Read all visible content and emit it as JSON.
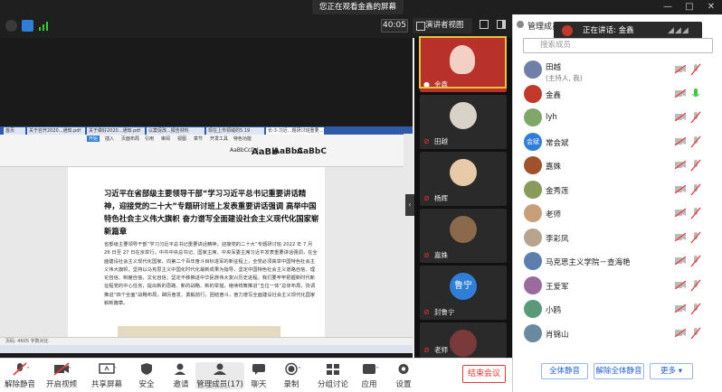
{
  "window": {
    "share_banner": "您正在观看金鑫的屏幕",
    "controls": [
      "—",
      "□",
      "✕"
    ]
  },
  "topbar": {
    "timer": "40:05",
    "view_mode": "演讲者视图"
  },
  "shared_screen": {
    "browser_tabs": [
      "首页",
      "关于召开2020...通知.pdf",
      "关于做好2020...通知.pdf",
      "以案促改...报告材料",
      "现在上市领域的5.19",
      "长-3-习近...题研讨班重要..."
    ],
    "ribbon_menus": [
      "开始",
      "插入",
      "页面布局",
      "引用",
      "审阅",
      "视图",
      "章节",
      "开发工具",
      "特色功能"
    ],
    "ribbon_styles": [
      "AaBbCcDd",
      "AaBb",
      "AaBbC",
      "AaBbC"
    ],
    "doc_title": "习近平在省部级主要领导干部“学习习近平总书记重要讲话精神，迎接党的二十大”专题研讨班上发表重要讲话强调 高举中国特色社会主义伟大旗帜 奋力谱写全面建设社会主义现代化国家崭新篇章",
    "doc_body": "省部级主要领导干部“学习习近平总书记重要讲话精神，迎接党的二十大”专题研讨班 2022 年 7 月 26 日至 27 日在京举行。中共中央总书记、国家主席、中央军委主席习近平发表重要讲话强调，在全面建设社会主义现代化国家、向第二个百年奋斗目标进军的新征程上，全党必须高举中国特色社会主义伟大旗帜，坚持以马克思主义中国化时代化最新成果为指导，坚定中国特色社会主义道路自信、理论自信、制度自信、文化自信，坚定不移推进中华民族伟大复兴历史进程。我们要牢牢把握新时代新征程党的中心任务，提出新的思路、新的战略、新的举措，继续统筹推进“五位一体”总体布局，协调推进“四个全面”战略布局，踔厉奋发、勇毅前行，团结奋斗，奋力谱写全面建设社会主义现代化国家崭新篇章。",
    "status": "页码: 4605    字数对比"
  },
  "gallery": [
    {
      "name": "金鑫",
      "muted": false
    },
    {
      "name": "田越",
      "muted": true
    },
    {
      "name": "杨辉",
      "muted": true
    },
    {
      "name": "嘉姝",
      "muted": true
    },
    {
      "name": "封鲁宁",
      "muted": true
    },
    {
      "name": "老师",
      "muted": true
    }
  ],
  "gallery_badge": "鲁宁",
  "toolbar": {
    "mute": "解除静音",
    "video": "开启视频",
    "share": "共享屏幕",
    "security": "安全",
    "invite": "邀请",
    "members": "管理成员(17)",
    "chat": "聊天",
    "record": "录制",
    "breakout": "分组讨论",
    "apps": "应用",
    "settings": "设置",
    "end": "结束会议"
  },
  "panel": {
    "title": "管理成员(1",
    "speaking": "正在讲话: 金鑫",
    "search_placeholder": "搜索成员",
    "members": [
      {
        "name": "田越",
        "sub": "(主持人, 我)",
        "color": "#6f7fa8"
      },
      {
        "name": "金鑫",
        "sub": "",
        "color": "#c0392b"
      },
      {
        "name": "lyh",
        "sub": "",
        "color": "#7ea86a"
      },
      {
        "name": "常会斌",
        "sub": "",
        "color": "#2f7ed8",
        "initials": "会斌"
      },
      {
        "name": "嘉姝",
        "sub": "",
        "color": "#a0522d"
      },
      {
        "name": "金秀莲",
        "sub": "",
        "color": "#8a9a5b"
      },
      {
        "name": "老师",
        "sub": "",
        "color": "#c7a07a"
      },
      {
        "name": "李彩凤",
        "sub": "",
        "color": "#b6a48f"
      },
      {
        "name": "马克思主义学院－查海艳",
        "sub": "",
        "color": "#5d7fb0"
      },
      {
        "name": "王爱军",
        "sub": "",
        "color": "#9b6b9e"
      },
      {
        "name": "小鸥",
        "sub": "",
        "color": "#5a9a7a"
      },
      {
        "name": "肖锦山",
        "sub": "",
        "color": "#6b8aa0"
      }
    ],
    "btn_mute_all": "全体静音",
    "btn_unmute_all": "解除全体静音",
    "btn_more": "更多 ▾"
  }
}
